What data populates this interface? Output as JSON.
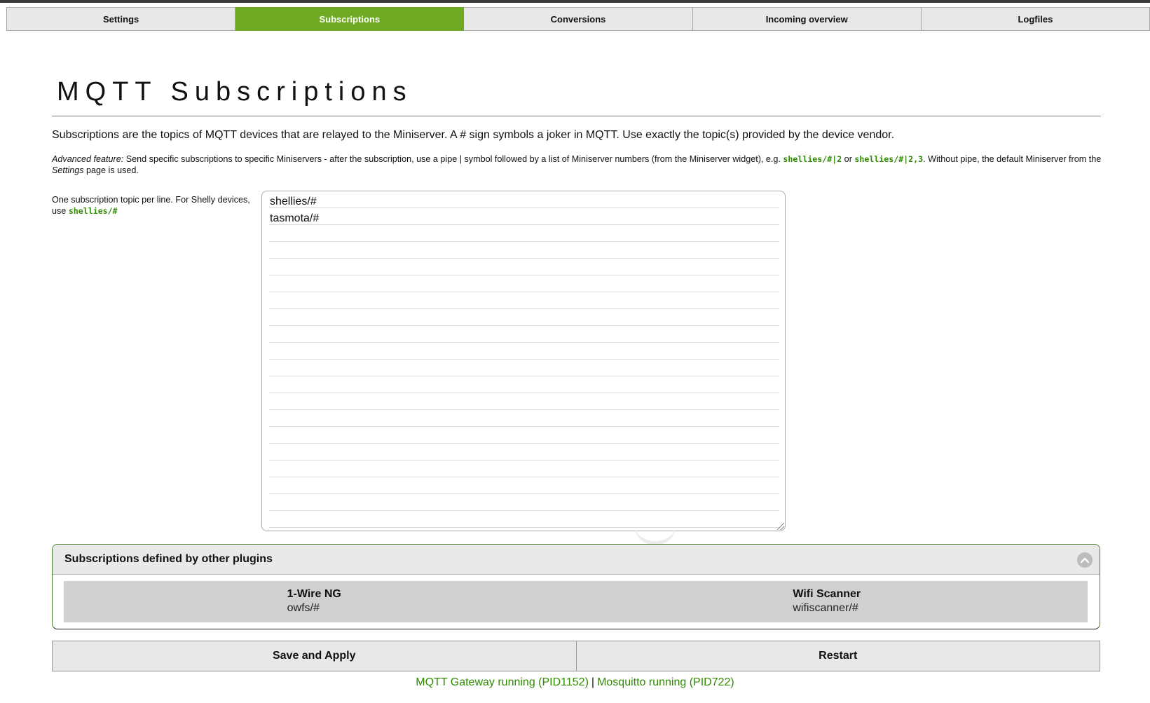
{
  "tabs": [
    {
      "label": "Settings"
    },
    {
      "label": "Subscriptions"
    },
    {
      "label": "Conversions"
    },
    {
      "label": "Incoming overview"
    },
    {
      "label": "Logfiles"
    }
  ],
  "active_tab": "Subscriptions",
  "title": "MQTT Subscriptions",
  "intro": "Subscriptions are the topics of MQTT devices that are relayed to the Miniserver. A # sign symbols a joker in MQTT. Use exactly the topic(s) provided by the device vendor.",
  "advanced": {
    "label": "Advanced feature:",
    "text1": " Send specific subscriptions to specific Miniservers - after the subscription, use a pipe | symbol followed by a list of Miniserver numbers (from the Miniserver widget), e.g. ",
    "code1": "shellies/#|2",
    "or": " or ",
    "code2": "shellies/#|2,3",
    "text2": ". Without pipe, the default Miniserver from the ",
    "settings": "Settings",
    "text3": " page is used."
  },
  "hint": {
    "text": "One subscription topic per line. For Shelly devices, use ",
    "code": "shellies/#"
  },
  "subscriptions": [
    "shellies/#",
    "tasmota/#"
  ],
  "other_plugins": {
    "header": "Subscriptions defined by other plugins",
    "plugins": [
      {
        "name": "1-Wire NG",
        "topic": "owfs/#"
      },
      {
        "name": "Wifi Scanner",
        "topic": "wifiscanner/#"
      }
    ]
  },
  "buttons": {
    "save": "Save and Apply",
    "restart": "Restart"
  },
  "status": {
    "gateway": "MQTT Gateway running (PID1152)",
    "separator": "|",
    "broker": "Mosquitto running (PID722)"
  },
  "colors": {
    "accent": "#6fab22",
    "ok_text": "#2e8b00",
    "code_text": "#2e8b00"
  }
}
